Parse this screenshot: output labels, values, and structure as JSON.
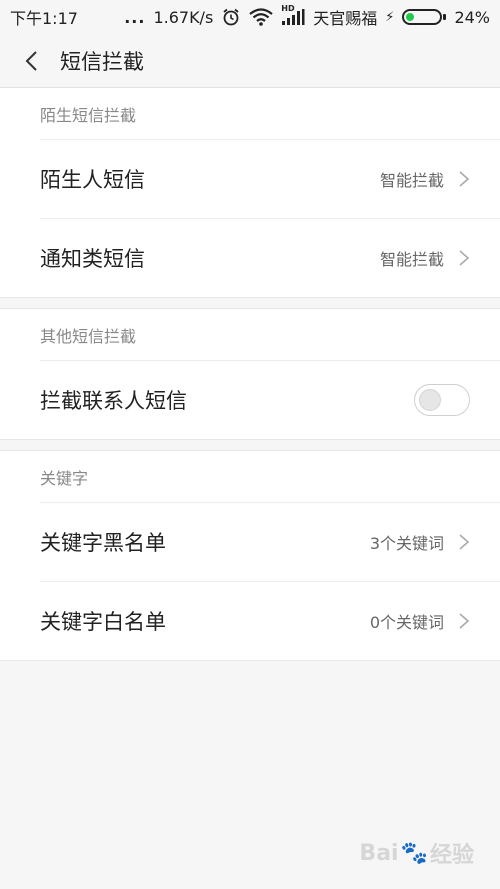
{
  "status_bar": {
    "time": "下午1:17",
    "dots": "...",
    "speed": "1.67K/s",
    "hd": "HD",
    "carrier": "天官赐福",
    "battery_pct": "24%",
    "battery_level": 0.24,
    "battery_color": "#21c94a"
  },
  "header": {
    "title": "短信拦截"
  },
  "sections": [
    {
      "header": "陌生短信拦截",
      "rows": [
        {
          "label": "陌生人短信",
          "value": "智能拦截"
        },
        {
          "label": "通知类短信",
          "value": "智能拦截"
        }
      ]
    },
    {
      "header": "其他短信拦截",
      "rows": [
        {
          "label": "拦截联系人短信",
          "toggle_on": false
        }
      ]
    },
    {
      "header": "关键字",
      "rows": [
        {
          "label": "关键字黑名单",
          "value": "3个关键词"
        },
        {
          "label": "关键字白名单",
          "value": "0个关键词"
        }
      ]
    }
  ],
  "watermark": {
    "brand": "Bai",
    "suffix": "经验"
  }
}
